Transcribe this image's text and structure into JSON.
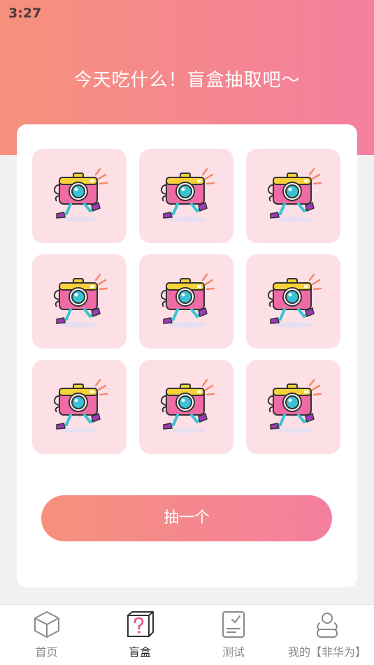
{
  "status_bar": {
    "time": "3:27"
  },
  "header": {
    "title": "今天吃什么！盲盒抽取吧～"
  },
  "grid": {
    "items": [
      {
        "icon": "walking-camera-icon"
      },
      {
        "icon": "walking-camera-icon"
      },
      {
        "icon": "walking-camera-icon"
      },
      {
        "icon": "walking-camera-icon"
      },
      {
        "icon": "walking-camera-icon"
      },
      {
        "icon": "walking-camera-icon"
      },
      {
        "icon": "walking-camera-icon"
      },
      {
        "icon": "walking-camera-icon"
      },
      {
        "icon": "walking-camera-icon"
      }
    ]
  },
  "draw_button": {
    "label": "抽一个"
  },
  "tabbar": {
    "tabs": [
      {
        "label": "首页",
        "icon": "cube-icon",
        "active": false
      },
      {
        "label": "盲盒",
        "icon": "mystery-box-icon",
        "active": true
      },
      {
        "label": "测试",
        "icon": "test-sheet-icon",
        "active": false
      },
      {
        "label": "我的【非华为】",
        "icon": "user-icon",
        "active": false
      }
    ]
  },
  "colors": {
    "gradient_start": "#f6917c",
    "gradient_end": "#f47f9e",
    "cell_background": "#fde0e6",
    "active_tab_accent": "#e8507a"
  }
}
